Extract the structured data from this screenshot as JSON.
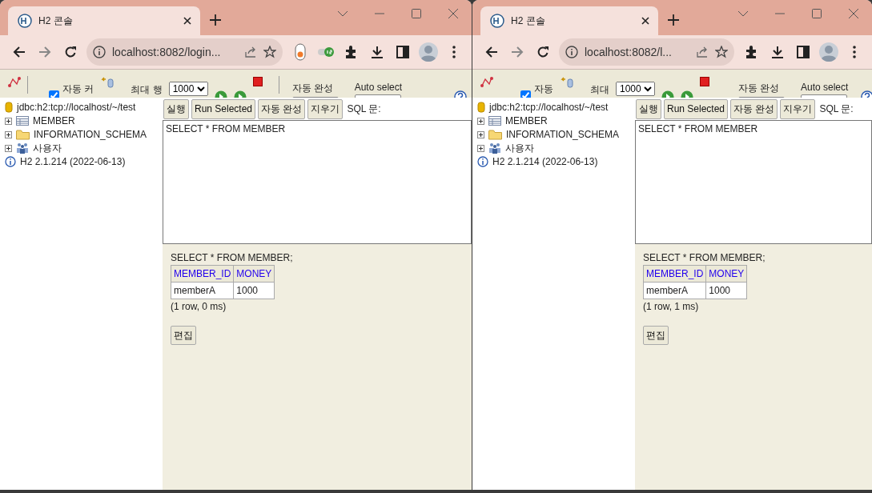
{
  "windows": [
    {
      "tab_title": "H2 콘솔",
      "url": "localhost:8082/login...",
      "extensions_pinned": true,
      "h2_toolbar": {
        "autocommit_label": "자동 커",
        "autocommit_checked": true,
        "max_rows_label": "최대 행",
        "max_rows_value": "1000",
        "autocomplete_label": "자동 완성",
        "autoselect_label": "Auto select"
      },
      "tree": {
        "connection": "jdbc:h2:tcp://localhost/~/test",
        "items": [
          {
            "label": "MEMBER",
            "kind": "table"
          },
          {
            "label": "INFORMATION_SCHEMA",
            "kind": "folder"
          },
          {
            "label": "사용자",
            "kind": "users"
          }
        ],
        "version": "H2 2.1.214 (2022-06-13)"
      },
      "buttons": [
        "실행",
        "Run Selected",
        "자동 완성",
        "지우기"
      ],
      "sql_label": "SQL 문:",
      "sql_text": "SELECT * FROM MEMBER",
      "result": {
        "statement": "SELECT * FROM MEMBER;",
        "columns": [
          "MEMBER_ID",
          "MONEY"
        ],
        "rows": [
          [
            "memberA",
            "1000"
          ]
        ],
        "footer": "(1 row, 0 ms)",
        "edit_button": "편집"
      }
    },
    {
      "tab_title": "H2 콘솔",
      "url": "localhost:8082/l...",
      "extensions_pinned": false,
      "h2_toolbar": {
        "autocommit_label": "자동",
        "autocommit_checked": true,
        "max_rows_label": "최대",
        "max_rows_value": "1000",
        "autocomplete_label": "자동 완성",
        "autoselect_label": "Auto select"
      },
      "tree": {
        "connection": "jdbc:h2:tcp://localhost/~/test",
        "items": [
          {
            "label": "MEMBER",
            "kind": "table"
          },
          {
            "label": "INFORMATION_SCHEMA",
            "kind": "folder"
          },
          {
            "label": "사용자",
            "kind": "users"
          }
        ],
        "version": "H2 2.1.214 (2022-06-13)"
      },
      "buttons": [
        "실행",
        "Run Selected",
        "자동 완성",
        "지우기"
      ],
      "sql_label": "SQL 문:",
      "sql_text": "SELECT * FROM MEMBER",
      "result": {
        "statement": "SELECT * FROM MEMBER;",
        "columns": [
          "MEMBER_ID",
          "MONEY"
        ],
        "rows": [
          [
            "memberA",
            "1000"
          ]
        ],
        "footer": "(1 row, 1 ms)",
        "edit_button": "편집"
      }
    }
  ]
}
